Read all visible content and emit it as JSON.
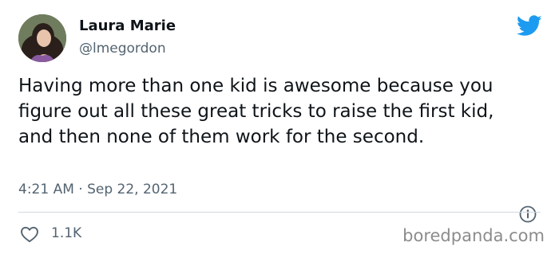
{
  "author": {
    "display_name": "Laura Marie",
    "handle": "@lmegordon"
  },
  "tweet": {
    "text": "Having more than one kid is awesome because you figure out all these great tricks to raise the first kid, and then none of them work for the second.",
    "timestamp": "4:21 AM · Sep 22, 2021",
    "like_count": "1.1K"
  },
  "watermark": "boredpanda.com",
  "icons": {
    "brand": "twitter-bird-icon",
    "info": "info-icon",
    "like": "heart-icon"
  },
  "colors": {
    "brand_blue": "#1d9bf0",
    "text_primary": "#0f1419",
    "text_secondary": "#536471"
  }
}
